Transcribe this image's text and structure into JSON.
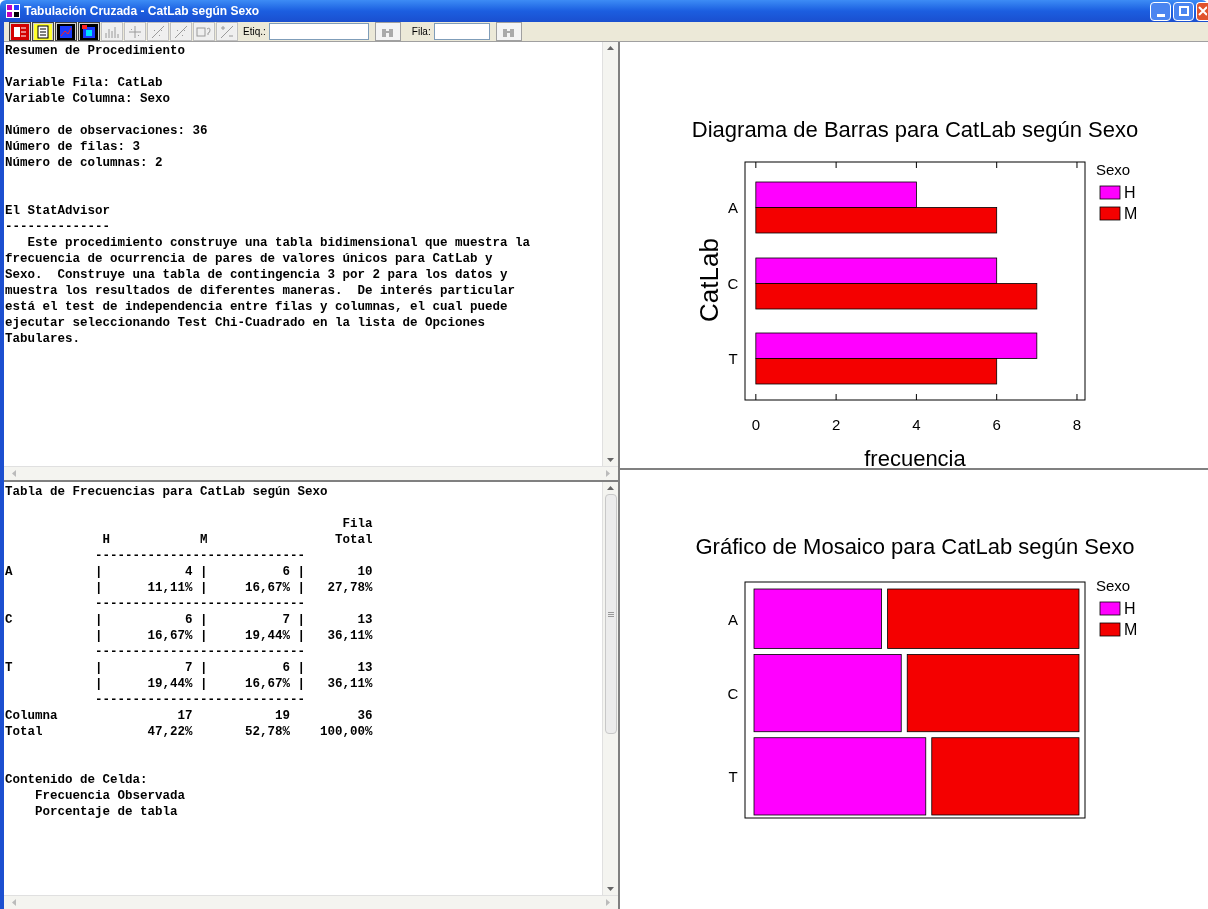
{
  "window": {
    "title": "Tabulación Cruzada - CatLab según Sexo"
  },
  "toolbar": {
    "buttons": [
      {
        "disabled": false
      },
      {
        "disabled": false
      },
      {
        "disabled": false
      },
      {
        "disabled": false
      },
      {
        "disabled": true
      },
      {
        "disabled": true
      },
      {
        "disabled": true
      },
      {
        "disabled": true
      },
      {
        "disabled": true
      },
      {
        "disabled": true
      }
    ],
    "label_field": {
      "label": "Etiq.:"
    },
    "row_field": {
      "label": "Fila:"
    }
  },
  "summary_pane": {
    "blocks": [
      {
        "kind": "heading",
        "lines": [
          "Resumen de Procedimiento"
        ]
      },
      {
        "kind": "group",
        "lines": [
          "Variable Fila: CatLab",
          "Variable Columna: Sexo"
        ]
      },
      {
        "kind": "group",
        "lines": [
          "Número de observaciones: 36",
          "Número de filas: 3",
          "Número de columnas: 2"
        ]
      },
      {
        "kind": "section",
        "lines": [
          "El StatAdvisor",
          "--------------"
        ]
      }
    ],
    "paragraph": "   Este procedimiento construye una tabla bidimensional que muestra la\nfrecuencia de ocurrencia de pares de valores únicos para CatLab y\nSexo.  Construye una tabla de contingencia 3 por 2 para los datos y\nmuestra los resultados de diferentes maneras.  De interés particular\nestá el test de independencia entre filas y columnas, el cual puede\nejecutar seleccionando Test Chi-Cuadrado en la lista de Opciones\nTabulares."
  },
  "table_pane": {
    "blocks": [
      {
        "kind": "heading",
        "lines": [
          "Tabla de Frecuencias para CatLab según Sexo"
        ]
      },
      {
        "kind": "group",
        "lines": [
          "                                             Fila",
          "             H            M                 Total",
          "            ----------------------------",
          "A           |           4 |          6 |       10",
          "            |      11,11% |     16,67% |   27,78%",
          "            ----------------------------",
          "C           |           6 |          7 |       13",
          "            |      16,67% |     19,44% |   36,11%",
          "            ----------------------------",
          "T           |           7 |          6 |       13",
          "            |      19,44% |     16,67% |   36,11%",
          "            ----------------------------",
          "Columna                17           19         36",
          "Total              47,22%       52,78%    100,00%"
        ]
      },
      {
        "kind": "section",
        "lines": [
          "Contenido de Celda:",
          "    Frecuencia Observada",
          "    Porcentaje de tabla"
        ]
      }
    ]
  },
  "bar_chart": {
    "chart_data": {
      "type": "bar",
      "orientation": "horizontal",
      "title": "Diagrama de Barras para CatLab según Sexo",
      "xlabel": "frecuencia",
      "ylabel": "CatLab",
      "categories": [
        "A",
        "C",
        "T"
      ],
      "legend": {
        "title": "Sexo"
      },
      "series": [
        {
          "name": "H",
          "color": "#ff00ff",
          "values": [
            4,
            6,
            7
          ]
        },
        {
          "name": "M",
          "color": "#f40000",
          "values": [
            6,
            7,
            6
          ]
        }
      ],
      "xlim": [
        -0.27,
        8.2
      ],
      "xticks": [
        0,
        2,
        4,
        6,
        8
      ]
    }
  },
  "mosaic_chart": {
    "title": "Gráfico de Mosaico para CatLab según Sexo",
    "row_labels": [
      "A",
      "C",
      "T"
    ],
    "legend_title": "Sexo",
    "legend": [
      {
        "label": "H",
        "color": "#ff00ff"
      },
      {
        "label": "M",
        "color": "#f40000"
      }
    ]
  }
}
